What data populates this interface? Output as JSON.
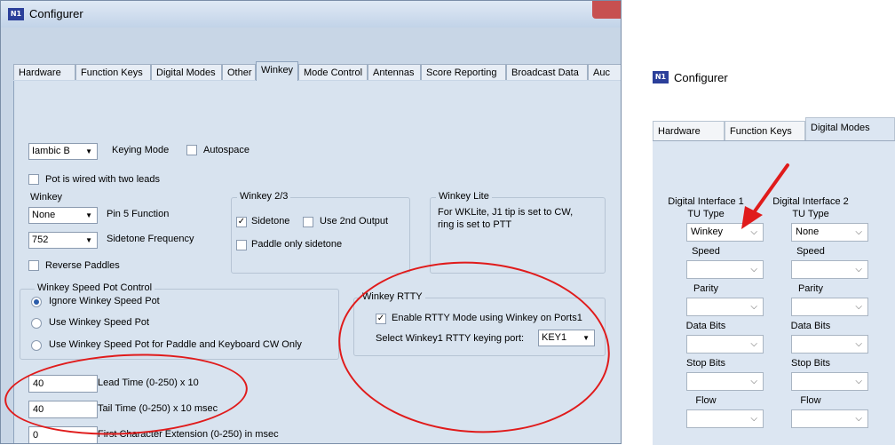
{
  "left_window": {
    "title": "Configurer",
    "logo_text": "N1MM",
    "tabs": [
      "Hardware",
      "Function Keys",
      "Digital Modes",
      "Other",
      "Winkey",
      "Mode Control",
      "Antennas",
      "Score Reporting",
      "Broadcast Data",
      "Auc"
    ],
    "active_tab": "Winkey",
    "keying_mode": {
      "value": "Iambic B",
      "label": "Keying Mode"
    },
    "autospace": {
      "label": "Autospace",
      "checked": false
    },
    "pot_two_leads": {
      "label": "Pot is wired with two leads",
      "checked": false
    },
    "winkey_group": {
      "legend": "Winkey",
      "pin5": {
        "value": "None",
        "label": "Pin 5 Function"
      },
      "sidetone_freq": {
        "value": "752",
        "label": "Sidetone Frequency"
      }
    },
    "winkey23_group": {
      "legend": "Winkey 2/3",
      "sidetone": {
        "label": "Sidetone",
        "checked": true
      },
      "use_2nd_output": {
        "label": "Use 2nd Output",
        "checked": false
      },
      "paddle_only_sidetone": {
        "label": "Paddle only sidetone",
        "checked": false
      }
    },
    "winkey_lite_group": {
      "legend": "Winkey Lite",
      "line1": "For WKLite, J1 tip is set to CW,",
      "line2": "ring is set to PTT"
    },
    "reverse_paddles": {
      "label": "Reverse Paddles",
      "checked": false
    },
    "speed_pot_group": {
      "legend": "Winkey Speed Pot Control",
      "options": [
        {
          "label": "Ignore Winkey Speed Pot",
          "selected": true
        },
        {
          "label": "Use Winkey Speed Pot",
          "selected": false
        },
        {
          "label": "Use Winkey Speed Pot for Paddle and Keyboard CW Only",
          "selected": false
        }
      ]
    },
    "rtty_group": {
      "legend": "Winkey RTTY",
      "enable": {
        "label": "Enable RTTY Mode using Winkey on Ports1",
        "checked": true
      },
      "port_label": "Select Winkey1 RTTY keying port:",
      "port_value": "KEY1"
    },
    "lead_time": {
      "value": "40",
      "label": "Lead Time (0-250) x 10"
    },
    "tail_time": {
      "value": "40",
      "label": "Tail Time (0-250) x 10 msec"
    },
    "first_char": {
      "value": "0",
      "label": "First Character Extension (0-250) in msec"
    }
  },
  "right_window": {
    "title": "Configurer",
    "logo_text": "N1MM",
    "tabs": [
      "Hardware",
      "Function Keys",
      "Digital Modes"
    ],
    "active_tab": "Digital Modes",
    "interface1": {
      "heading": "Digital Interface 1",
      "tu_type_label": "TU Type",
      "tu_type_value": "Winkey",
      "speed_label": "Speed",
      "parity_label": "Parity",
      "data_bits_label": "Data Bits",
      "stop_bits_label": "Stop Bits",
      "flow_label": "Flow"
    },
    "interface2": {
      "heading": "Digital Interface 2",
      "tu_type_label": "TU Type",
      "tu_type_value": "None",
      "speed_label": "Speed",
      "parity_label": "Parity",
      "data_bits_label": "Data Bits",
      "stop_bits_label": "Stop Bits",
      "flow_label": "Flow"
    }
  },
  "colors": {
    "annotation_red": "#e01b1b",
    "window_bg": "#d8e3ef"
  }
}
